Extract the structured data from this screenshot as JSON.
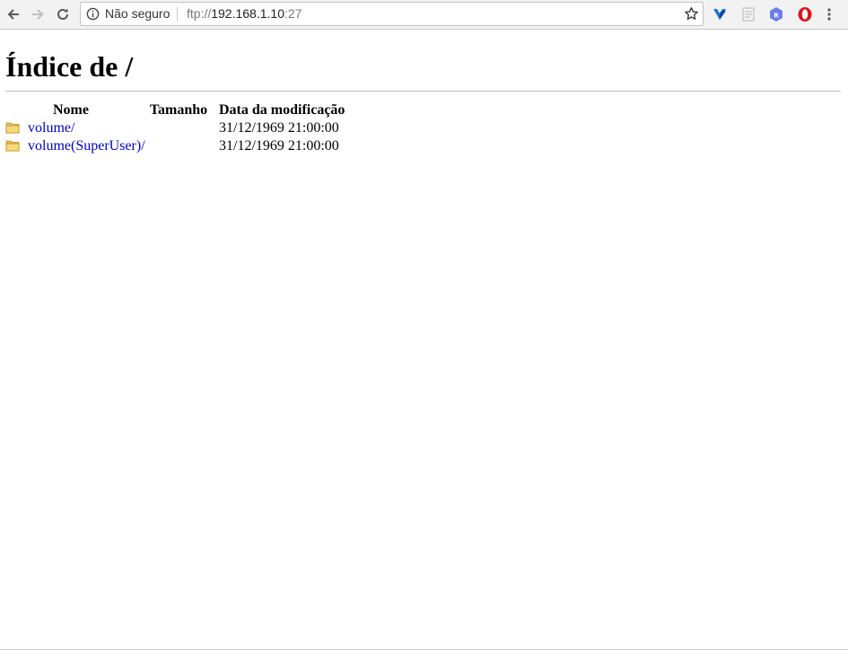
{
  "browser": {
    "security_label": "Não seguro",
    "url": {
      "scheme": "ftp://",
      "host": "192.168.1.10",
      "port": ":27"
    },
    "icons": {
      "back": "back-arrow-icon",
      "forward": "forward-arrow-icon",
      "reload": "reload-icon",
      "info": "info-icon",
      "bookmark": "star-icon",
      "menu": "more-vertical-icon"
    },
    "extensions": [
      "vpn-extension-icon",
      "document-extension-icon",
      "hexagon-r-extension-icon",
      "opera-extension-icon"
    ],
    "colors": {
      "toolbar": "#f2f2f2",
      "link": "#0000cc",
      "opera": "#e0141e",
      "hexagon": "#6c7de6",
      "vpn": "#1976d2"
    }
  },
  "page": {
    "title": "Índice de /",
    "columns": {
      "name": "Nome",
      "size": "Tamanho",
      "date": "Data da modificação"
    },
    "entries": [
      {
        "name": "volume/",
        "size": "",
        "date": "31/12/1969 21:00:00",
        "icon": "folder-icon"
      },
      {
        "name": "volume(SuperUser)/",
        "size": "",
        "date": "31/12/1969 21:00:00",
        "icon": "folder-icon"
      }
    ]
  }
}
